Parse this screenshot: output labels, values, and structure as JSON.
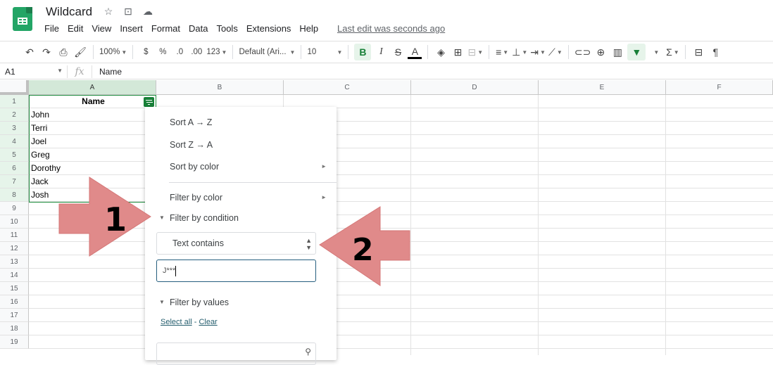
{
  "app": {
    "title": "Wildcard",
    "title_icons": [
      "star-icon",
      "move-to-folder-icon",
      "cloud-saved-icon"
    ],
    "menu": [
      "File",
      "Edit",
      "View",
      "Insert",
      "Format",
      "Data",
      "Tools",
      "Extensions",
      "Help"
    ],
    "last_edit": "Last edit was seconds ago"
  },
  "toolbar": {
    "zoom": "100%",
    "currency": "$",
    "percent": "%",
    "dec_decrease": ".0",
    "dec_increase": ".00",
    "format_more": "123",
    "font": "Default (Ari...",
    "font_size": "10",
    "bold": "B",
    "italic": "I",
    "strike": "S",
    "text_color": "A"
  },
  "formula_bar": {
    "cell_ref": "A1",
    "fx": "fx",
    "value": "Name"
  },
  "grid": {
    "columns": [
      "A",
      "B",
      "C",
      "D",
      "E",
      "F"
    ],
    "rows": [
      "1",
      "2",
      "3",
      "4",
      "5",
      "6",
      "7",
      "8",
      "9",
      "10",
      "11",
      "12",
      "13",
      "14",
      "15",
      "16",
      "17",
      "18",
      "19"
    ],
    "column_a": [
      "Name",
      "John",
      "Terri",
      "Joel",
      "Greg",
      "Dorothy",
      "Jack",
      "Josh"
    ]
  },
  "filter_menu": {
    "sort_az": "Sort A → Z",
    "sort_za": "Sort Z → A",
    "sort_by_color": "Sort by color",
    "filter_by_color": "Filter by color",
    "filter_by_condition": "Filter by condition",
    "condition_select": "Text contains",
    "condition_value": "J***",
    "filter_by_values": "Filter by values",
    "select_all": "Select all",
    "separator": "-",
    "clear": "Clear",
    "search_value": ""
  },
  "annotations": {
    "arrow1_label": "1",
    "arrow2_label": "2",
    "arrow_color": "#e08a8a"
  },
  "colors": {
    "brand_green": "#188038",
    "selection_green": "#1e8e3e",
    "column_selected_bg": "#d3e8d8"
  }
}
